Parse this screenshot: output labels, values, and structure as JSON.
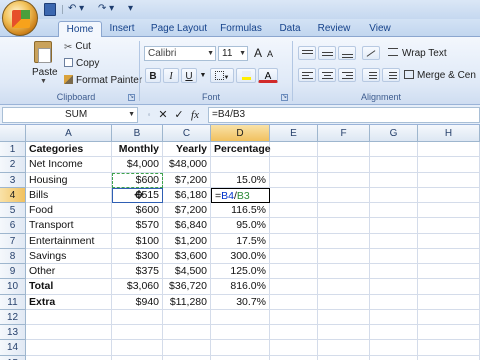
{
  "quick_access": {
    "undo_glyph": "↶ ▾",
    "redo_glyph": "↷ ▾",
    "more_glyph": "▾"
  },
  "tabs": [
    "Home",
    "Insert",
    "Page Layout",
    "Formulas",
    "Data",
    "Review",
    "View"
  ],
  "active_tab": "Home",
  "clipboard": {
    "paste_label": "Paste",
    "cut_label": "Cut",
    "copy_label": "Copy",
    "format_painter_label": "Format Painter",
    "group_label": "Clipboard"
  },
  "font": {
    "font_name": "Calibri",
    "font_size": "11",
    "grow_label": "A",
    "shrink_label": "A",
    "bold_label": "B",
    "italic_label": "I",
    "underline_label": "U",
    "font_color_label": "A",
    "group_label": "Font"
  },
  "alignment": {
    "wrap_text_label": "Wrap Text",
    "merge_label": "Merge & Cen",
    "group_label": "Alignment"
  },
  "formula_bar": {
    "name_box": "SUM",
    "cancel_glyph": "✕",
    "enter_glyph": "✓",
    "fx_label": "fx",
    "formula": "=B4/B3"
  },
  "columns": [
    "A",
    "B",
    "C",
    "D",
    "E",
    "F",
    "G",
    "H"
  ],
  "rows": [
    {
      "n": "1",
      "a": "Categories",
      "b": "Monthly",
      "c": "Yearly",
      "d": "Percentage"
    },
    {
      "n": "2",
      "a": "Net Income",
      "b": "$4,000",
      "c": "$48,000",
      "d": ""
    },
    {
      "n": "3",
      "a": "Housing",
      "b": "$600",
      "c": "$7,200",
      "d": "15.0%"
    },
    {
      "n": "4",
      "a": "Bills",
      "b": "$515",
      "c": "$6,180",
      "d": "=B4/B3"
    },
    {
      "n": "5",
      "a": "Food",
      "b": "$600",
      "c": "$7,200",
      "d": "116.5%"
    },
    {
      "n": "6",
      "a": "Transport",
      "b": "$570",
      "c": "$6,840",
      "d": "95.0%"
    },
    {
      "n": "7",
      "a": "Entertainment",
      "b": "$100",
      "c": "$1,200",
      "d": "17.5%"
    },
    {
      "n": "8",
      "a": "Savings",
      "b": "$300",
      "c": "$3,600",
      "d": "300.0%"
    },
    {
      "n": "9",
      "a": "Other",
      "b": "$375",
      "c": "$4,500",
      "d": "125.0%"
    },
    {
      "n": "10",
      "a": "Total",
      "b": "$3,060",
      "c": "$36,720",
      "d": "816.0%"
    },
    {
      "n": "11",
      "a": "Extra",
      "b": "$940",
      "c": "$11,280",
      "d": "30.7%"
    },
    {
      "n": "12",
      "a": "",
      "b": "",
      "c": "",
      "d": ""
    },
    {
      "n": "13",
      "a": "",
      "b": "",
      "c": "",
      "d": ""
    },
    {
      "n": "14",
      "a": "",
      "b": "",
      "c": "",
      "d": ""
    },
    {
      "n": "15",
      "a": "",
      "b": "",
      "c": "",
      "d": ""
    }
  ],
  "editing_cell": {
    "ref_1": "B4",
    "slash": "/",
    "ref_2": "B3",
    "eq": "="
  }
}
